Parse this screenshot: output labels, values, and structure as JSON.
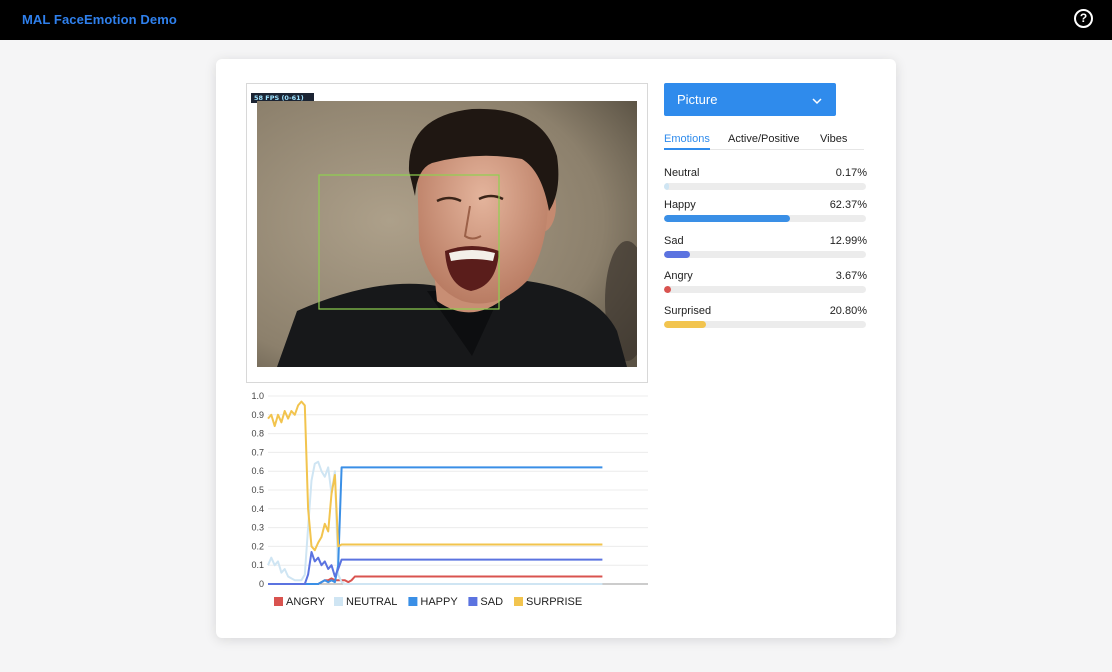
{
  "app": {
    "title": "MAL FaceEmotion Demo",
    "help_icon": "question-circle-icon",
    "help_glyph": "?"
  },
  "video": {
    "fps_label": "58 FPS (0-61)"
  },
  "source_select": {
    "value": "Picture",
    "icon": "chevron-down-icon"
  },
  "tabs": [
    {
      "label": "Emotions",
      "active": true
    },
    {
      "label": "Active/Positive",
      "active": false
    },
    {
      "label": "Vibes",
      "active": false
    }
  ],
  "emotions": [
    {
      "label": "Neutral",
      "value": "0.17%",
      "fraction": 0.0017,
      "color": "#cfe5f3"
    },
    {
      "label": "Happy",
      "value": "62.37%",
      "fraction": 0.6237,
      "color": "#3a8fe6"
    },
    {
      "label": "Sad",
      "value": "12.99%",
      "fraction": 0.1299,
      "color": "#5b73e0"
    },
    {
      "label": "Angry",
      "value": "3.67%",
      "fraction": 0.0367,
      "color": "#d9534f"
    },
    {
      "label": "Surprised",
      "value": "20.80%",
      "fraction": 0.208,
      "color": "#f2c44e"
    }
  ],
  "chart_data": {
    "type": "line",
    "ylim": [
      0,
      1
    ],
    "y_ticks": [
      "0",
      "0.1",
      "0.2",
      "0.3",
      "0.4",
      "0.5",
      "0.6",
      "0.7",
      "0.8",
      "0.9",
      "1.0"
    ],
    "grid": true,
    "legend_position": "bottom",
    "x": [
      0,
      2,
      4,
      6,
      8,
      10,
      12,
      14,
      16,
      18,
      20,
      22,
      24,
      26,
      28,
      30,
      32,
      34,
      36,
      38,
      40,
      42,
      44,
      46,
      48,
      50,
      52,
      54,
      56,
      58,
      60,
      62,
      64,
      66,
      68,
      70,
      72,
      74,
      76,
      78,
      80,
      90,
      100,
      120,
      140,
      160,
      180,
      200
    ],
    "series": [
      {
        "name": "ANGRY",
        "color": "#d9534f",
        "values": [
          0,
          0,
          0,
          0,
          0,
          0,
          0,
          0,
          0,
          0,
          0,
          0,
          0,
          0,
          0,
          0,
          0.01,
          0.02,
          0.02,
          0.03,
          0.02,
          0.02,
          0.02,
          0.02,
          0.01,
          0.02,
          0.04,
          0.04,
          0.04,
          0.04,
          0.04,
          0.04,
          0.04,
          0.04,
          0.04,
          0.04,
          0.04,
          0.04,
          0.04,
          0.04,
          0.04,
          0.04,
          0.04,
          0.04,
          0.04,
          0.04,
          0.04,
          0.04
        ]
      },
      {
        "name": "NEUTRAL",
        "color": "#cfe5f3",
        "values": [
          0.1,
          0.14,
          0.1,
          0.12,
          0.06,
          0.08,
          0.04,
          0.03,
          0.02,
          0.02,
          0.02,
          0.05,
          0.3,
          0.55,
          0.64,
          0.65,
          0.6,
          0.57,
          0.62,
          0.48,
          0.6,
          0.05,
          0.01,
          0,
          0,
          0,
          0,
          0,
          0,
          0,
          0,
          0,
          0,
          0,
          0,
          0,
          0,
          0,
          0,
          0,
          0,
          0,
          0,
          0,
          0,
          0,
          0,
          0
        ]
      },
      {
        "name": "HAPPY",
        "color": "#3a8fe6",
        "values": [
          0,
          0,
          0,
          0,
          0,
          0,
          0,
          0,
          0,
          0,
          0,
          0,
          0,
          0,
          0,
          0,
          0.01,
          0.02,
          0.01,
          0.02,
          0.01,
          0.1,
          0.62,
          0.62,
          0.62,
          0.62,
          0.62,
          0.62,
          0.62,
          0.62,
          0.62,
          0.62,
          0.62,
          0.62,
          0.62,
          0.62,
          0.62,
          0.62,
          0.62,
          0.62,
          0.62,
          0.62,
          0.62,
          0.62,
          0.62,
          0.62,
          0.62,
          0.62
        ]
      },
      {
        "name": "SAD",
        "color": "#5b73e0",
        "values": [
          0,
          0,
          0,
          0,
          0,
          0,
          0,
          0,
          0,
          0,
          0,
          0,
          0.05,
          0.17,
          0.12,
          0.14,
          0.1,
          0.12,
          0.08,
          0.1,
          0.04,
          0.08,
          0.13,
          0.13,
          0.13,
          0.13,
          0.13,
          0.13,
          0.13,
          0.13,
          0.13,
          0.13,
          0.13,
          0.13,
          0.13,
          0.13,
          0.13,
          0.13,
          0.13,
          0.13,
          0.13,
          0.13,
          0.13,
          0.13,
          0.13,
          0.13,
          0.13,
          0.13
        ]
      },
      {
        "name": "SURPRISE",
        "color": "#f2c44e",
        "values": [
          0.88,
          0.9,
          0.84,
          0.9,
          0.86,
          0.92,
          0.88,
          0.92,
          0.9,
          0.95,
          0.97,
          0.95,
          0.4,
          0.2,
          0.18,
          0.22,
          0.25,
          0.32,
          0.28,
          0.48,
          0.58,
          0.2,
          0.21,
          0.21,
          0.21,
          0.21,
          0.21,
          0.21,
          0.21,
          0.21,
          0.21,
          0.21,
          0.21,
          0.21,
          0.21,
          0.21,
          0.21,
          0.21,
          0.21,
          0.21,
          0.21,
          0.21,
          0.21,
          0.21,
          0.21,
          0.21,
          0.21,
          0.21
        ]
      }
    ]
  }
}
